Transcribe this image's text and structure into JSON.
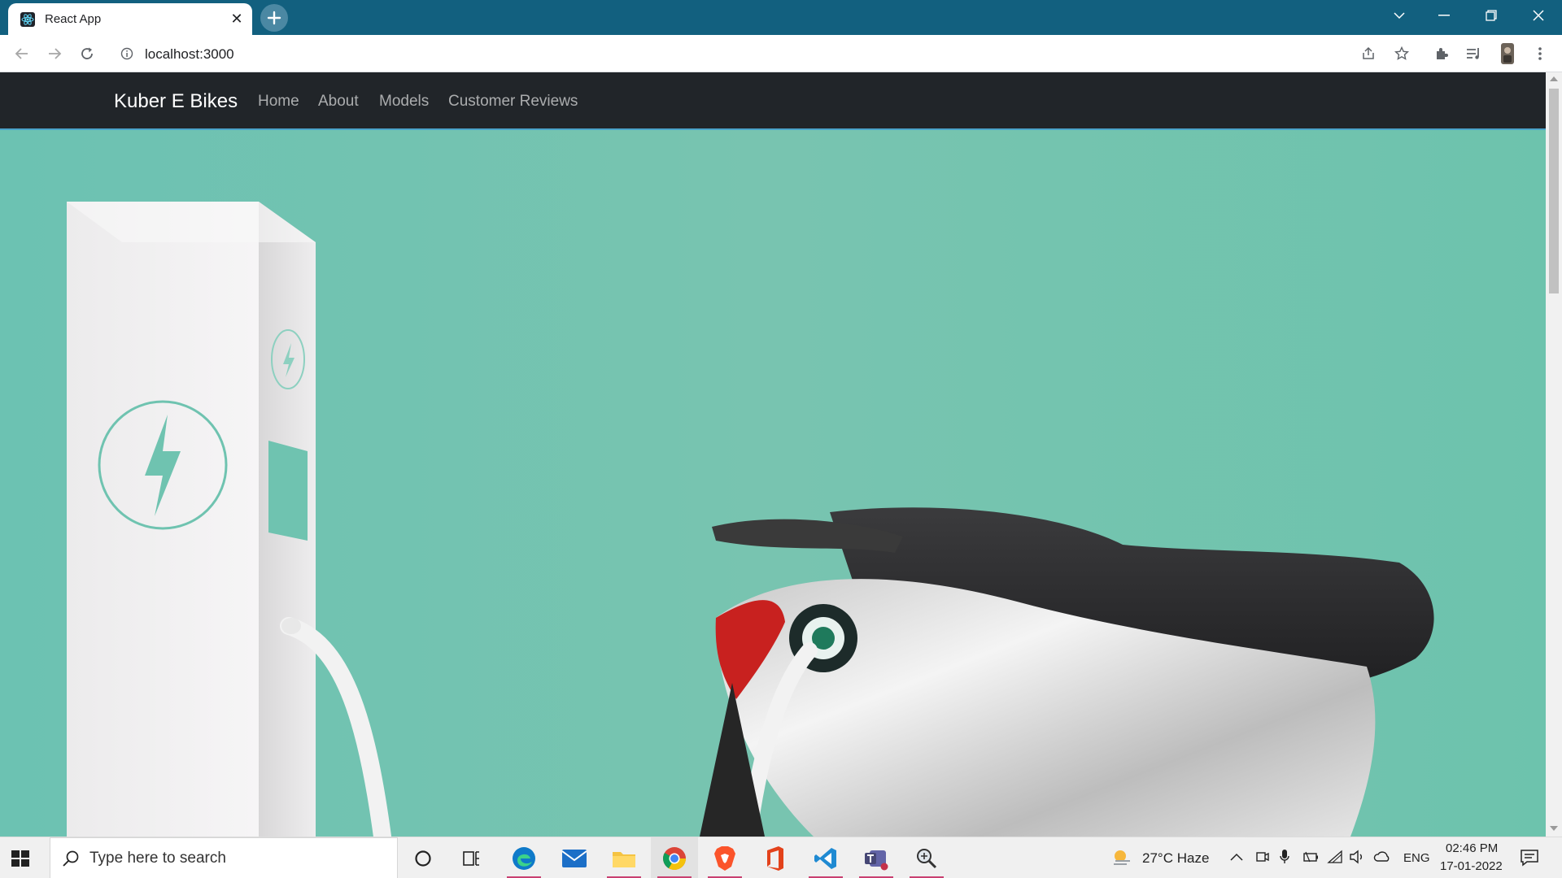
{
  "browser": {
    "tab_title": "React App",
    "url": "localhost:3000"
  },
  "navbar": {
    "brand": "Kuber E Bikes",
    "links": [
      "Home",
      "About",
      "Models",
      "Customer Reviews"
    ]
  },
  "taskbar": {
    "search_placeholder": "Type here to search",
    "weather": "27°C  Haze",
    "language": "ENG",
    "time": "02:46 PM",
    "date": "17-01-2022"
  },
  "colors": {
    "titlebar": "#12607f",
    "navbar": "#212529",
    "hero_background": "#6fc3b0"
  }
}
